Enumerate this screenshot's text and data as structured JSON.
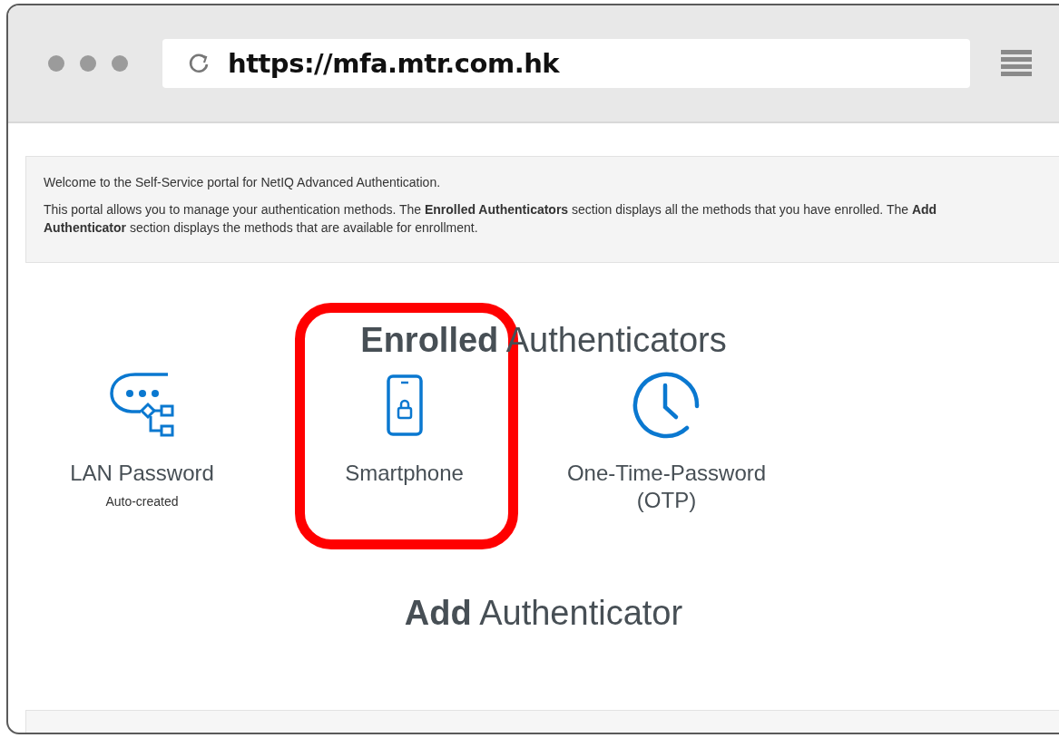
{
  "browser": {
    "url": "https://mfa.mtr.com.hk"
  },
  "intro": {
    "paragraphs": [
      "Welcome to the Self-Service portal for NetIQ Advanced Authentication.",
      "This portal allows you to manage your authentication methods. The **Enrolled Authenticators** section displays all the methods that you have enrolled. The **Add Authenticator** section displays the methods that are available for enrollment."
    ]
  },
  "enrolled": {
    "heading": "**Enrolled** Authenticators",
    "authenticators": [
      {
        "kind": "lan",
        "label": "LAN Password",
        "note": "Auto-created",
        "highlighted": false
      },
      {
        "kind": "smartphone",
        "label": "Smartphone",
        "highlighted": true
      },
      {
        "kind": "otp",
        "label": "One-Time-Password (OTP)",
        "highlighted": false
      }
    ]
  },
  "add": {
    "heading": "**Add** Authenticator"
  }
}
